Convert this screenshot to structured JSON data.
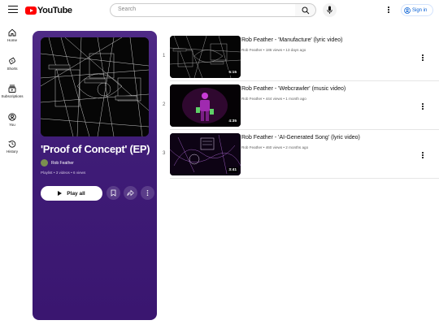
{
  "header": {
    "logo_text": "YouTube",
    "search_placeholder": "Search",
    "signin_label": "Sign in"
  },
  "nav": [
    {
      "label": "Home",
      "icon": "home-icon"
    },
    {
      "label": "Shorts",
      "icon": "shorts-icon"
    },
    {
      "label": "Subscriptions",
      "icon": "subscriptions-icon"
    },
    {
      "label": "You",
      "icon": "you-icon"
    },
    {
      "label": "History",
      "icon": "history-icon"
    }
  ],
  "playlist": {
    "title": "'Proof of Concept' (EP)",
    "owner": "Rob Feather",
    "meta": "Playlist • 3 videos • 6 views",
    "play_all_label": "Play all",
    "background_color": "#3f1c77"
  },
  "videos": [
    {
      "index": "1",
      "title": "Rob Feather - 'Manufacture' (lyric video)",
      "meta": "Rob Feather • 186 views • 13 days ago",
      "duration": "5:15"
    },
    {
      "index": "2",
      "title": "Rob Feather - 'Webcrawler' (music video)",
      "meta": "Rob Feather • 444 views • 1 month ago",
      "duration": "4:35"
    },
    {
      "index": "3",
      "title": "Rob Feather - 'AI-Generated Song' (lyric video)",
      "meta": "Rob Feather • 460 views • 2 months ago",
      "duration": "3:41"
    }
  ]
}
